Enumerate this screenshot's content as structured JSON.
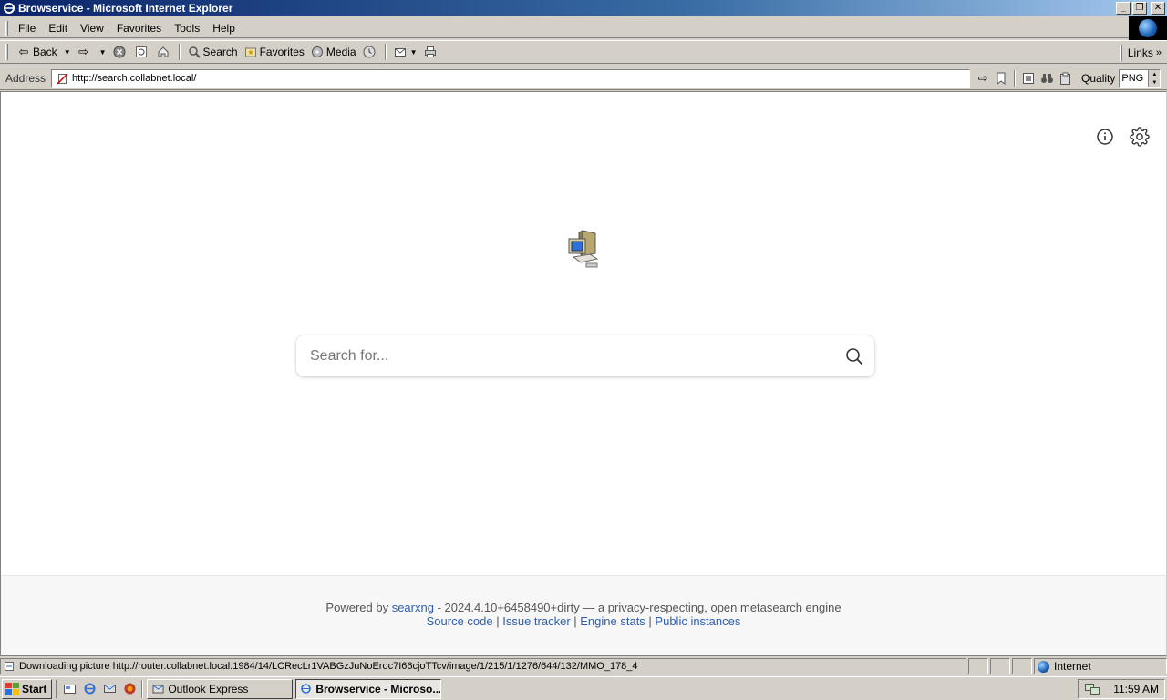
{
  "window": {
    "title": "Browservice - Microsoft Internet Explorer",
    "minimize_glyph": "_",
    "maximize_glyph": "❐",
    "close_glyph": "✕"
  },
  "menubar": {
    "items": [
      "File",
      "Edit",
      "View",
      "Favorites",
      "Tools",
      "Help"
    ]
  },
  "toolbar": {
    "back_label": "Back",
    "search_label": "Search",
    "favorites_label": "Favorites",
    "media_label": "Media",
    "links_label": "Links"
  },
  "address": {
    "label": "Address",
    "url": "http://search.collabnet.local/",
    "quality_label": "Quality",
    "quality_value": "PNG"
  },
  "page": {
    "search_placeholder": "Search for...",
    "footer": {
      "powered_by": "Powered by",
      "engine_link": "searxng",
      "version_text": " - 2024.4.10+6458490+dirty — a privacy-respecting, open metasearch engine",
      "links": [
        "Source code",
        "Issue tracker",
        "Engine stats",
        "Public instances"
      ],
      "separator": " | "
    }
  },
  "status": {
    "text": "Downloading picture http://router.collabnet.local:1984/14/LCRecLr1VABGzJuNoEroc7I66cjoTTcv/image/1/215/1/1276/644/132/MMO_178_4",
    "zone": "Internet"
  },
  "taskbar": {
    "start_label": "Start",
    "tasks": [
      "Outlook Express",
      "Browservice - Microso..."
    ],
    "clock": "11:59 AM"
  },
  "colors": {
    "titlebar_start": "#0a246a",
    "titlebar_end": "#a6caf0",
    "chrome": "#d4d0c8",
    "link": "#2e5fb3"
  }
}
